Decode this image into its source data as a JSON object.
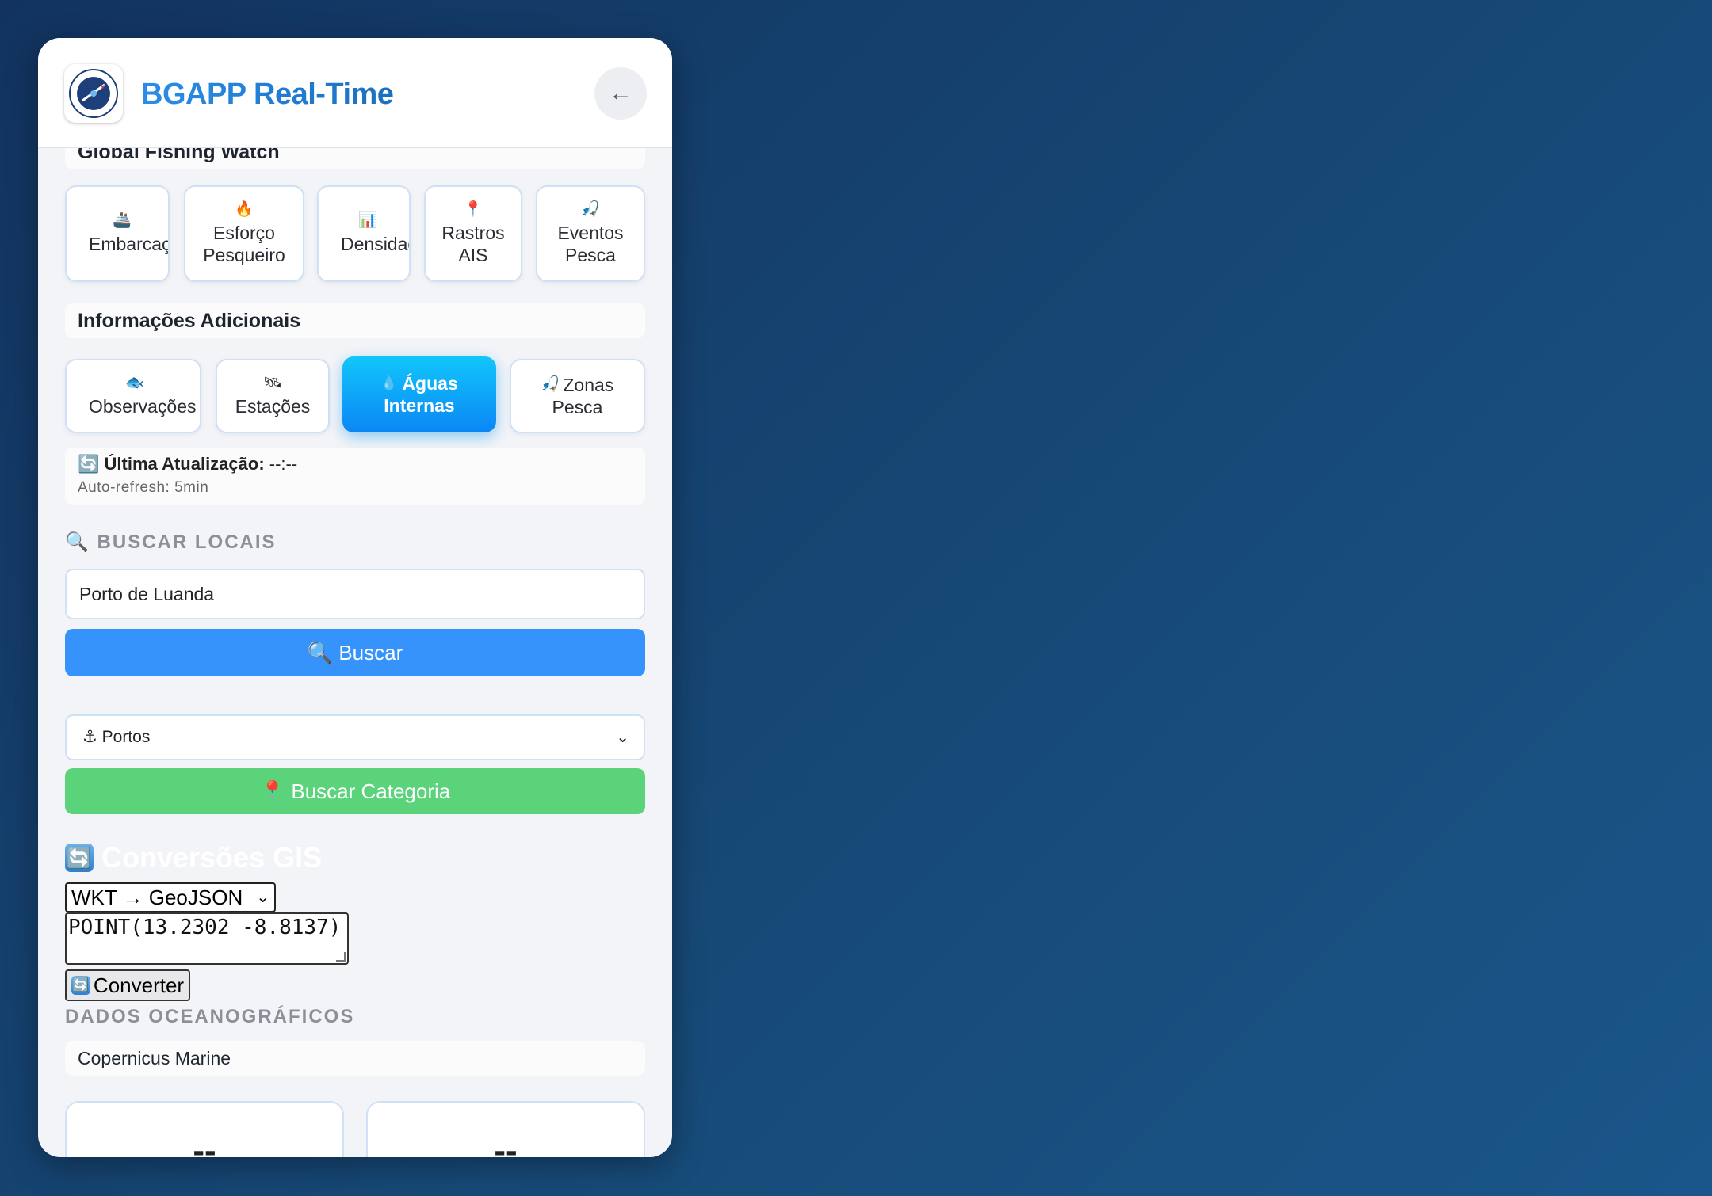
{
  "header": {
    "title": "BGAPP Real-Time",
    "logo_icon": "maritime-angola-logo",
    "back_label": "←"
  },
  "gfw": {
    "section_title": "Global Fishing Watch",
    "cards": [
      {
        "emoji": "🚢",
        "label": "Embarcações"
      },
      {
        "emoji": "🔥",
        "label1": "Esforço",
        "label2": "Pesqueiro"
      },
      {
        "emoji": "📊",
        "label": "Densidade"
      },
      {
        "emoji": "📍",
        "label1": "Rastros",
        "label2": "AIS"
      },
      {
        "emoji": "🎣",
        "label1": "Eventos",
        "label2": "Pesca"
      }
    ]
  },
  "extra": {
    "section_title": "Informações Adicionais",
    "cards": [
      {
        "emoji": "🐟",
        "label": "Observações"
      },
      {
        "emoji": "🛰",
        "label": "Estações"
      },
      {
        "emoji": "💧",
        "label1": "Águas",
        "label2": "Internas"
      },
      {
        "emoji": "🎣",
        "label1": "Zonas",
        "label2": "Pesca"
      }
    ]
  },
  "status": {
    "emoji": "🔄",
    "label": "Última Atualização:",
    "value": "--:--",
    "sub": "Auto-refresh: 5min"
  },
  "search": {
    "heading": "🔍 BUSCAR LOCAIS",
    "input_value": "Porto de Luanda",
    "button_label": "🔍 Buscar",
    "category_value": "⚓ Portos",
    "category_button_label": "📍 Buscar Categoria"
  },
  "gis": {
    "title": "Conversões GIS",
    "sync_glyph": "🔄",
    "select_value": "WKT → GeoJSON",
    "textarea_value": "POINT(13.2302 -8.8137)",
    "convert_label": "Converter"
  },
  "ocean": {
    "heading": "DADOS OCEANOGRÁFICOS",
    "source": "Copernicus Marine",
    "metric1": "--",
    "metric2": "--"
  },
  "colors": {
    "accent_blue": "#3593fb",
    "accent_green": "#5bd37a",
    "active_card": "#0b86f5"
  }
}
